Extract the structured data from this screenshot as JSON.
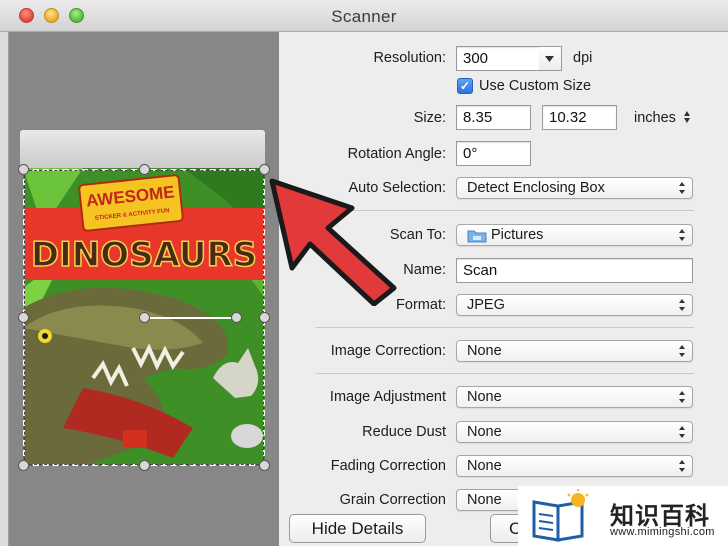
{
  "window": {
    "title": "Scanner"
  },
  "scan_settings": {
    "resolution": {
      "label": "Resolution:",
      "value": "300",
      "unit": "dpi"
    },
    "custom_size": {
      "label": "Use Custom Size",
      "checked": true
    },
    "size": {
      "label": "Size:",
      "width": "8.35",
      "height": "10.32",
      "unit": "inches"
    },
    "rotation": {
      "label": "Rotation Angle:",
      "value": "0°"
    },
    "auto_selection": {
      "label": "Auto Selection:",
      "value": "Detect Enclosing Box"
    },
    "scan_to": {
      "label": "Scan To:",
      "value": "Pictures"
    },
    "name": {
      "label": "Name:",
      "value": "Scan"
    },
    "format": {
      "label": "Format:",
      "value": "JPEG"
    },
    "image_correction": {
      "label": "Image Correction:",
      "value": "None"
    },
    "image_adjustment": {
      "label": "Image Adjustment",
      "value": "None"
    },
    "reduce_dust": {
      "label": "Reduce Dust",
      "value": "None"
    },
    "fading_correction": {
      "label": "Fading Correction",
      "value": "None"
    },
    "grain_correction": {
      "label": "Grain Correction",
      "value": "None"
    }
  },
  "buttons": {
    "hide_details": "Hide Details",
    "cancel_partial": "C"
  },
  "preview": {
    "cover_badge": "AWESOME",
    "cover_subtitle": "STICKER & ACTIVITY FUN",
    "cover_title": "DINOSAURS"
  },
  "watermark": {
    "text": "知识百科",
    "url": "www.mimingshi.com"
  },
  "colors": {
    "accent": "#2b73e0",
    "arrow": "#e23a3a",
    "cover_bg": "#4a9a2a"
  }
}
